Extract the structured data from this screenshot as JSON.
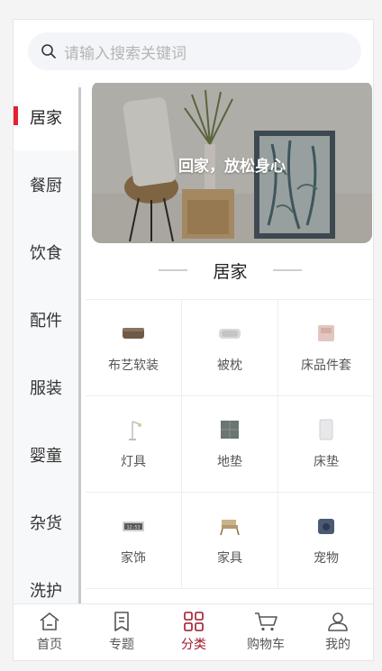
{
  "search": {
    "placeholder": "请输入搜索关键词"
  },
  "sidebar": {
    "items": [
      {
        "label": "居家",
        "active": true
      },
      {
        "label": "餐厨"
      },
      {
        "label": "饮食"
      },
      {
        "label": "配件"
      },
      {
        "label": "服装"
      },
      {
        "label": "婴童"
      },
      {
        "label": "杂货"
      },
      {
        "label": "洗护"
      }
    ]
  },
  "banner": {
    "text": "回家，放松身心"
  },
  "category": {
    "title": "居家",
    "items": [
      {
        "label": "布艺软装",
        "icon": "cushion-icon"
      },
      {
        "label": "被枕",
        "icon": "pillow-icon"
      },
      {
        "label": "床品件套",
        "icon": "bedding-set-icon"
      },
      {
        "label": "灯具",
        "icon": "lamp-icon"
      },
      {
        "label": "地垫",
        "icon": "floor-mat-icon"
      },
      {
        "label": "床垫",
        "icon": "mattress-icon"
      },
      {
        "label": "家饰",
        "icon": "clock-decor-icon"
      },
      {
        "label": "家具",
        "icon": "chair-icon"
      },
      {
        "label": "宠物",
        "icon": "pet-bed-icon"
      }
    ]
  },
  "tabbar": {
    "items": [
      {
        "label": "首页",
        "icon": "home-icon"
      },
      {
        "label": "专题",
        "icon": "bookmark-icon"
      },
      {
        "label": "分类",
        "icon": "grid-icon",
        "active": true
      },
      {
        "label": "购物车",
        "icon": "cart-icon"
      },
      {
        "label": "我的",
        "icon": "user-icon"
      }
    ]
  },
  "colors": {
    "accent": "#e4222f",
    "active_tab": "#9b1b2d"
  }
}
